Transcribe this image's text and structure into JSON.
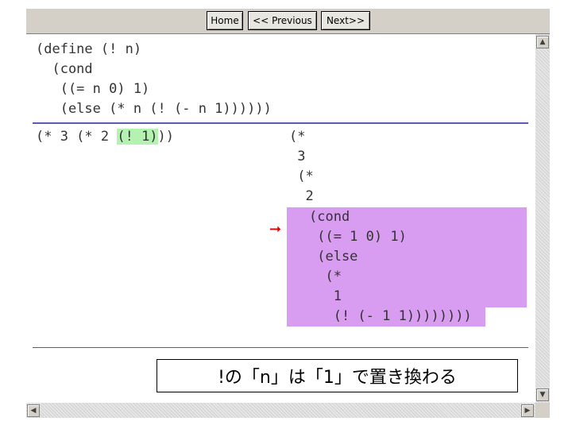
{
  "nav": {
    "home": "Home",
    "previous": "<< Previous",
    "next": "Next>>"
  },
  "code": {
    "define": "(define (! n)\n  (cond\n   ((= n 0) 1)\n   (else (* n (! (- n 1))))))",
    "expr_prefix": "(* 3 (* 2 ",
    "expr_highlight": "(! 1)",
    "expr_suffix": "))",
    "stack_top": "(*\n 3\n (*\n  2",
    "stack_bottom": "(cond\n ((= 1 0) 1)\n (else\n  (*\n   1\n   (! (- 1 1))))))))"
  },
  "caption": "!の「n」は「1」で置き換わる",
  "icons": {
    "arrow": "right-arrow-icon",
    "scroll_up": "▲",
    "scroll_down": "▼",
    "scroll_left": "◀",
    "scroll_right": "▶"
  },
  "colors": {
    "highlight_green": "#b3f2b0",
    "highlight_purple": "#d89cf0",
    "divider_blue": "#5a5ab4",
    "arrow_red": "#e00000"
  }
}
